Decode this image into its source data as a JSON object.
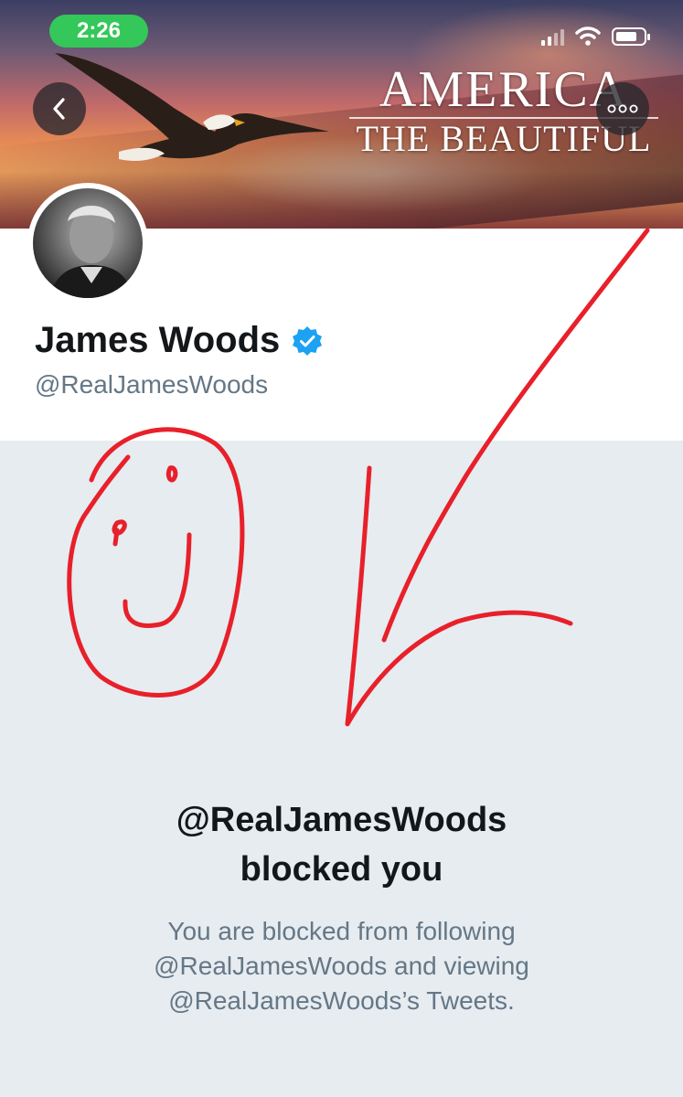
{
  "status_bar": {
    "time": "2:26"
  },
  "banner": {
    "line1": "AMERICA",
    "line2": "THE BEAUTIFUL"
  },
  "profile": {
    "name": "James Woods",
    "handle": "@RealJamesWoods",
    "verified": true
  },
  "blocked": {
    "title_line1": "@RealJamesWoods",
    "title_line2": "blocked you",
    "message_line1": "You are blocked from following",
    "message_line2": "@RealJamesWoods and viewing",
    "message_line3": "@RealJamesWoods’s Tweets."
  },
  "colors": {
    "verified_blue": "#1da1f2",
    "status_green": "#34c759",
    "annotation_red": "#e8202a",
    "secondary_text": "#657786"
  },
  "icons": [
    "back-chevron-icon",
    "more-options-icon",
    "verified-badge-icon",
    "signal-icon",
    "wifi-icon",
    "battery-icon"
  ]
}
